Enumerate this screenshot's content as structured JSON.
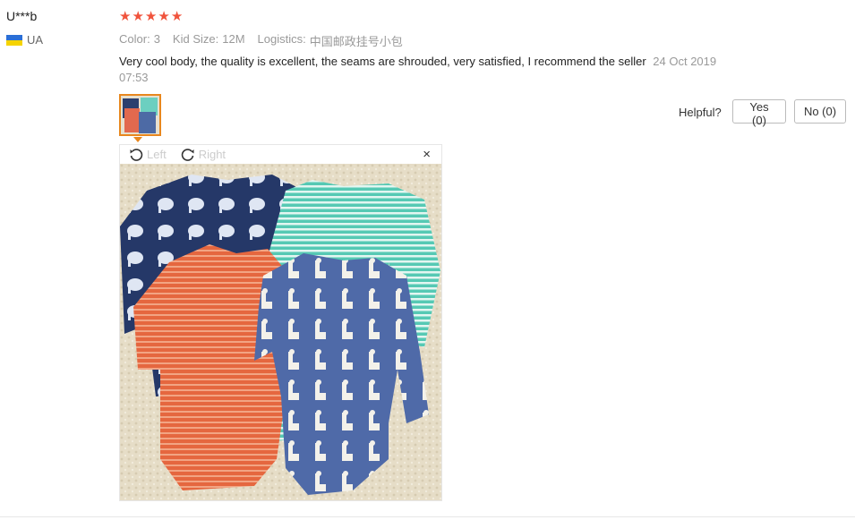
{
  "reviewer": {
    "name": "U***b",
    "country_code": "UA",
    "flag_colors": [
      "#2b6fd6",
      "#f5d300"
    ]
  },
  "rating": {
    "stars": 5,
    "max": 5,
    "star_color": "#f0533c"
  },
  "attributes": {
    "color_label": "Color:",
    "color_value": "3",
    "size_label": "Kid Size:",
    "size_value": "12M",
    "logistics_label": "Logistics:",
    "logistics_value": "中国邮政挂号小包"
  },
  "review": {
    "text": "Very cool body, the quality is excellent, the seams are shrouded, very satisfied, I recommend the seller",
    "date": "24 Oct 2019 07:53"
  },
  "helpful": {
    "label": "Helpful?",
    "yes_label": "Yes (0)",
    "no_label": "No (0)"
  },
  "viewer": {
    "rotate_left_label": "Left",
    "rotate_right_label": "Right",
    "close_glyph": "×"
  },
  "accent_color": "#e8871e"
}
